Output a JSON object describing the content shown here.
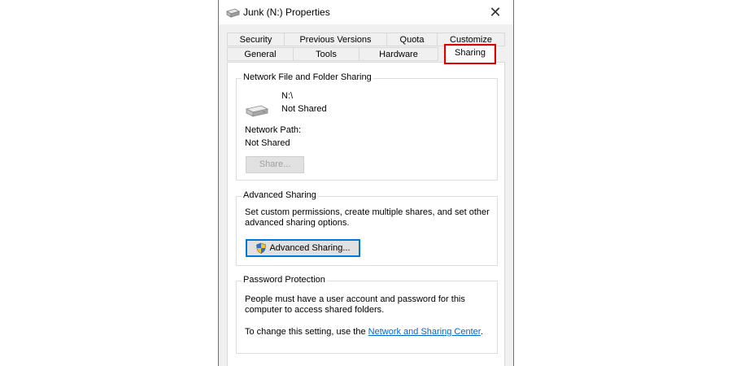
{
  "window": {
    "title": "Junk (N:) Properties",
    "close_glyph": "✕"
  },
  "tabs": {
    "row1": [
      "Security",
      "Previous Versions",
      "Quota",
      "Customize"
    ],
    "row2": [
      "General",
      "Tools",
      "Hardware",
      "Sharing"
    ],
    "active": "Sharing"
  },
  "network_sharing": {
    "group_title": "Network File and Folder Sharing",
    "drive_label": "N:\\",
    "share_status": "Not Shared",
    "network_path_label": "Network Path:",
    "network_path_value": "Not Shared",
    "share_button": "Share...",
    "drive_icon": "drive-icon"
  },
  "advanced_sharing": {
    "group_title": "Advanced Sharing",
    "description_line1": "Set custom permissions, create multiple shares, and set other",
    "description_line2": "advanced sharing options.",
    "button_label": "Advanced Sharing...",
    "button_icon": "uac-shield-icon"
  },
  "password_protection": {
    "group_title": "Password Protection",
    "text_line1": "People must have a user account and password for this",
    "text_line2": "computer to access shared folders.",
    "change_prefix": "To change this setting, use the ",
    "link_text": "Network and Sharing Center",
    "change_suffix": "."
  },
  "colors": {
    "highlight": "#e00000",
    "link": "#0066cc",
    "focus_border": "#0078d7"
  }
}
